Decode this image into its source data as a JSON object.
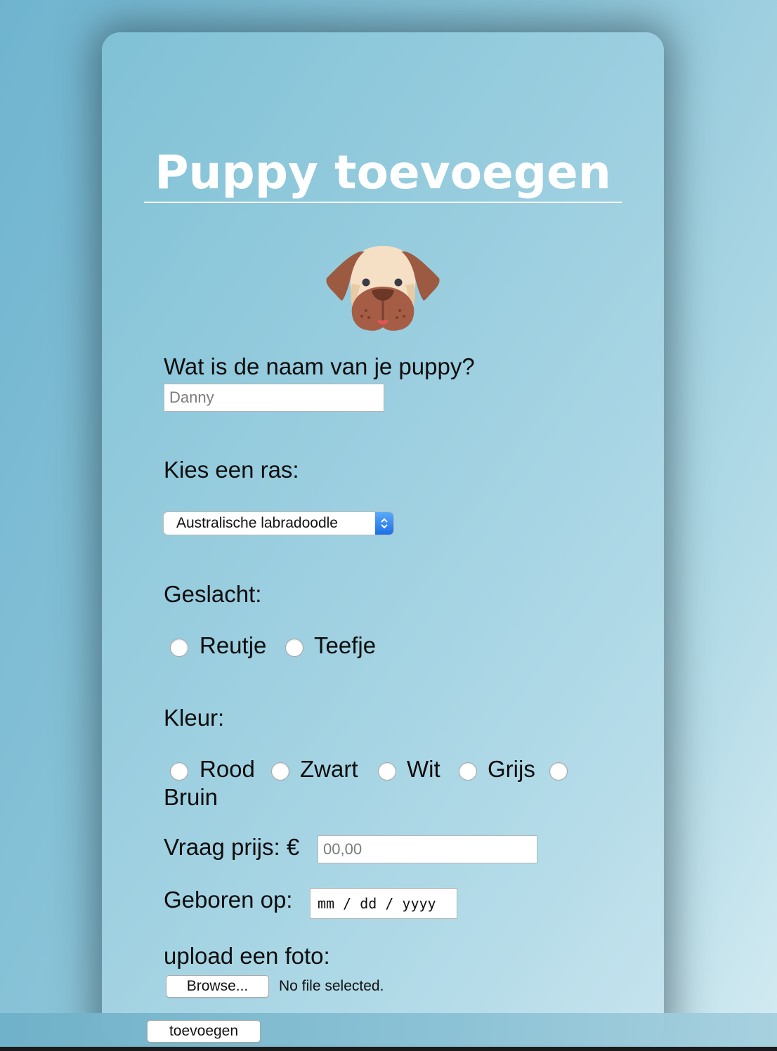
{
  "page": {
    "title": "Puppy toevoegen"
  },
  "form": {
    "name_label": "Wat is de naam van je puppy?",
    "name_placeholder": "Danny",
    "breed_label": "Kies een ras:",
    "breed_selected": "Australische labradoodle",
    "gender_label": "Geslacht:",
    "gender_options": [
      "Reutje",
      "Teefje"
    ],
    "color_label": "Kleur:",
    "color_options": [
      "Rood",
      "Zwart",
      "Wit",
      "Grijs",
      "Bruin"
    ],
    "price_label": "Vraag prijs: €",
    "price_placeholder": "00,00",
    "birth_label": "Geboren op:",
    "birth_placeholder": "mm / dd / yyyy",
    "photo_label": "upload een foto:",
    "browse_label": "Browse...",
    "file_status": "No file selected.",
    "submit_label": "toevoegen"
  },
  "icons": {
    "logo": "dog-face-icon",
    "select_arrow": "chevron-up-down-icon"
  },
  "colors": {
    "accent": "#ffffff",
    "select_button": "#1c6fe6"
  }
}
